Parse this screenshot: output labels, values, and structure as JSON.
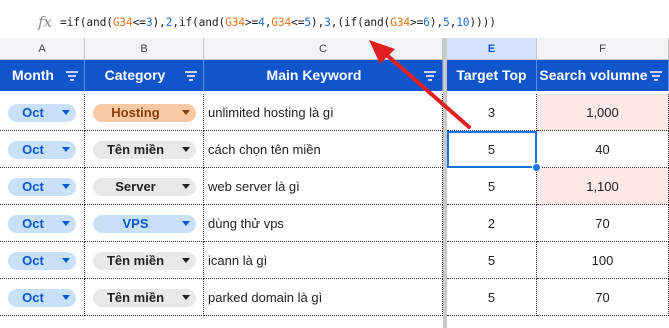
{
  "formula_bar": {
    "icon": "fx",
    "segments": [
      {
        "text": "=if(and(",
        "kind": "plain"
      },
      {
        "text": "G34",
        "kind": "ref"
      },
      {
        "text": "<=",
        "kind": "plain"
      },
      {
        "text": "3",
        "kind": "num"
      },
      {
        "text": "),",
        "kind": "plain"
      },
      {
        "text": "2",
        "kind": "num"
      },
      {
        "text": ",if(and(",
        "kind": "plain"
      },
      {
        "text": "G34",
        "kind": "ref"
      },
      {
        "text": ">=",
        "kind": "plain"
      },
      {
        "text": "4",
        "kind": "num"
      },
      {
        "text": ",",
        "kind": "plain"
      },
      {
        "text": "G34",
        "kind": "ref"
      },
      {
        "text": "<=",
        "kind": "plain"
      },
      {
        "text": "5",
        "kind": "num"
      },
      {
        "text": "),",
        "kind": "plain"
      },
      {
        "text": "3",
        "kind": "num"
      },
      {
        "text": ",(if(and(",
        "kind": "plain"
      },
      {
        "text": "G34",
        "kind": "ref"
      },
      {
        "text": ">=",
        "kind": "plain"
      },
      {
        "text": "6",
        "kind": "num"
      },
      {
        "text": "),",
        "kind": "plain"
      },
      {
        "text": "5",
        "kind": "num"
      },
      {
        "text": ",",
        "kind": "plain"
      },
      {
        "text": "10",
        "kind": "num"
      },
      {
        "text": "))))",
        "kind": "plain"
      }
    ]
  },
  "column_letters": [
    "A",
    "B",
    "C",
    "E",
    "F"
  ],
  "headers": {
    "month": "Month",
    "category": "Category",
    "keyword": "Main Keyword",
    "target": "Target Top",
    "volume": "Search volumne"
  },
  "colors": {
    "header_bg": "#1155cc",
    "month_chip": "#c9e1f8",
    "hosting_chip": "#f9c9a4",
    "gray_chip": "#e8e8e8",
    "vps_chip": "#c9e1f8",
    "highlight_cell": "#fce8e6",
    "arrow": "#e02020"
  },
  "rows": [
    {
      "month": "Oct",
      "category": "Hosting",
      "cat_style": "hosting",
      "keyword": "unlimited hosting là gì",
      "target": "3",
      "volume": "1,000",
      "vol_highlight": true
    },
    {
      "month": "Oct",
      "category": "Tên miền",
      "cat_style": "gray",
      "keyword": "cách chọn tên miền",
      "target": "5",
      "volume": "40",
      "vol_highlight": false
    },
    {
      "month": "Oct",
      "category": "Server",
      "cat_style": "gray",
      "keyword": "web server là gì",
      "target": "5",
      "volume": "1,100",
      "vol_highlight": true
    },
    {
      "month": "Oct",
      "category": "VPS",
      "cat_style": "vps",
      "keyword": "dùng thử vps",
      "target": "2",
      "volume": "70",
      "vol_highlight": false
    },
    {
      "month": "Oct",
      "category": "Tên miền",
      "cat_style": "gray",
      "keyword": "icann là gì",
      "target": "5",
      "volume": "100",
      "vol_highlight": false
    },
    {
      "month": "Oct",
      "category": "Tên miền",
      "cat_style": "gray",
      "keyword": "parked domain là gì",
      "target": "5",
      "volume": "70",
      "vol_highlight": false
    }
  ]
}
